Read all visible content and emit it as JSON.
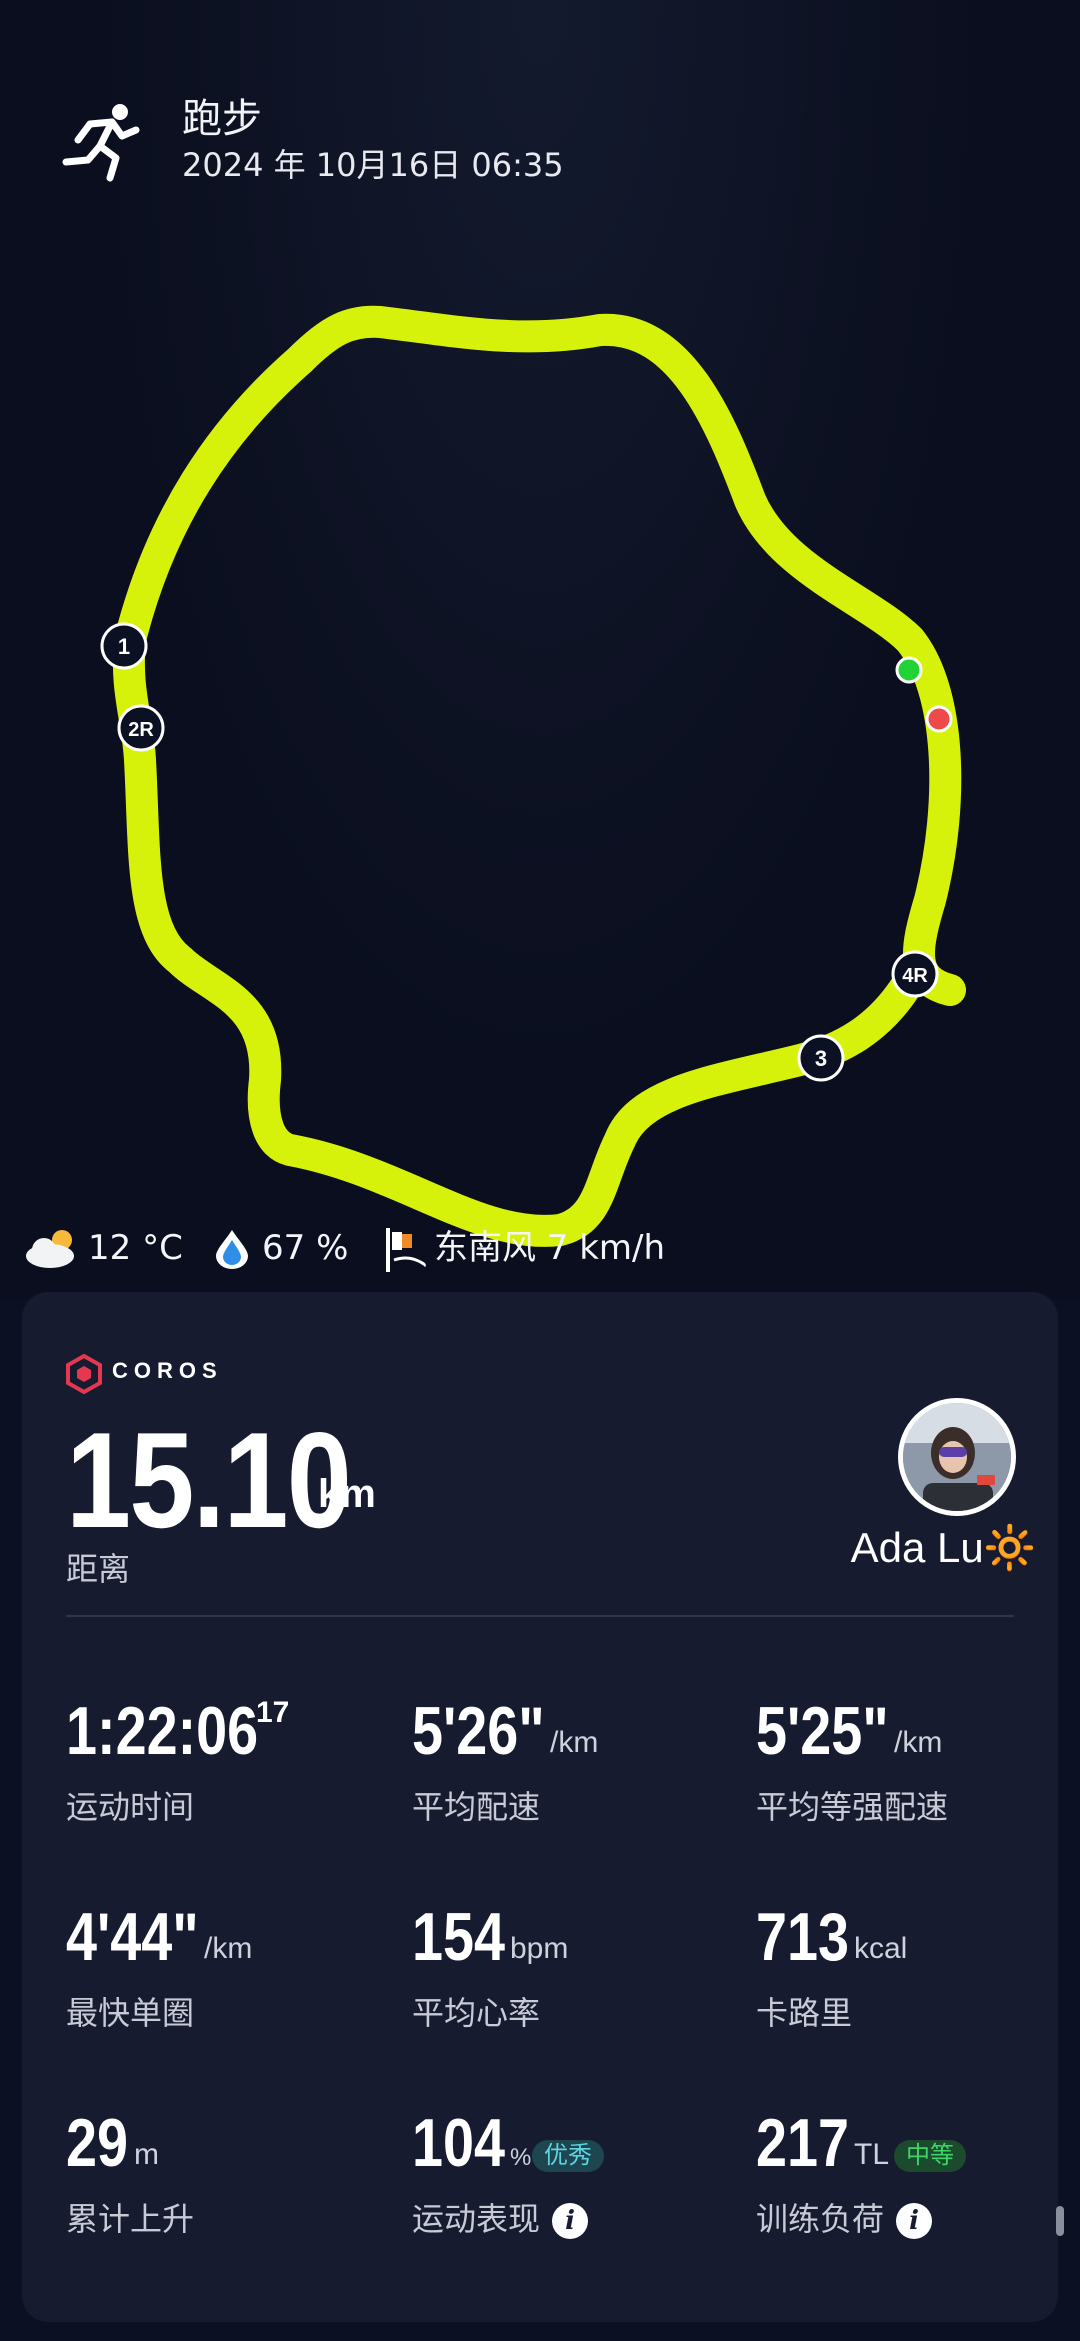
{
  "header": {
    "activity_title": "跑步",
    "datetime": "2024 年 10月16日  06:35",
    "activity_icon": "running-person-icon"
  },
  "route_map": {
    "lap_markers": [
      "1",
      "2R",
      "3",
      "4R"
    ],
    "route_color": "#d7f20a",
    "start_color": "#22d336",
    "end_color": "#ef4a4a"
  },
  "weather": {
    "temperature": "12 °C",
    "humidity": "67 %",
    "wind": "东南风 7 km/h",
    "icons": [
      "partly-cloudy-icon",
      "humidity-drop-icon",
      "wind-flag-icon"
    ]
  },
  "summary": {
    "brand": "COROS",
    "distance_value": "15.10",
    "distance_unit": "km",
    "distance_label": "距离",
    "user_name": "Ada Lu🔆"
  },
  "stats": {
    "duration": {
      "value": "1:22:06",
      "sup": "17",
      "label": "运动时间"
    },
    "avg_pace": {
      "value": "5'26\"",
      "unit": "/km",
      "label": "平均配速"
    },
    "adj_pace": {
      "value": "5'25\"",
      "unit": "/km",
      "label": "平均等强配速"
    },
    "best_lap": {
      "value": "4'44\"",
      "unit": "/km",
      "label": "最快单圈"
    },
    "avg_hr": {
      "value": "154",
      "unit": "bpm",
      "label": "平均心率"
    },
    "calories": {
      "value": "713",
      "unit": "kcal",
      "label": "卡路里"
    },
    "ascent": {
      "value": "29",
      "unit": "m",
      "label": "累计上升"
    },
    "performance": {
      "value": "104",
      "unit": "%",
      "badge": "优秀",
      "label": "运动表现"
    },
    "training_load": {
      "value": "217",
      "unit": "TL",
      "badge": "中等",
      "label": "训练负荷"
    }
  },
  "colors": {
    "background": "#0b1022",
    "card": "#161b30",
    "badge_excellent_bg": "#1d4650",
    "badge_excellent_fg": "#5fd3e0",
    "badge_medium_bg": "#1b4a2c",
    "badge_medium_fg": "#3fd46a"
  }
}
